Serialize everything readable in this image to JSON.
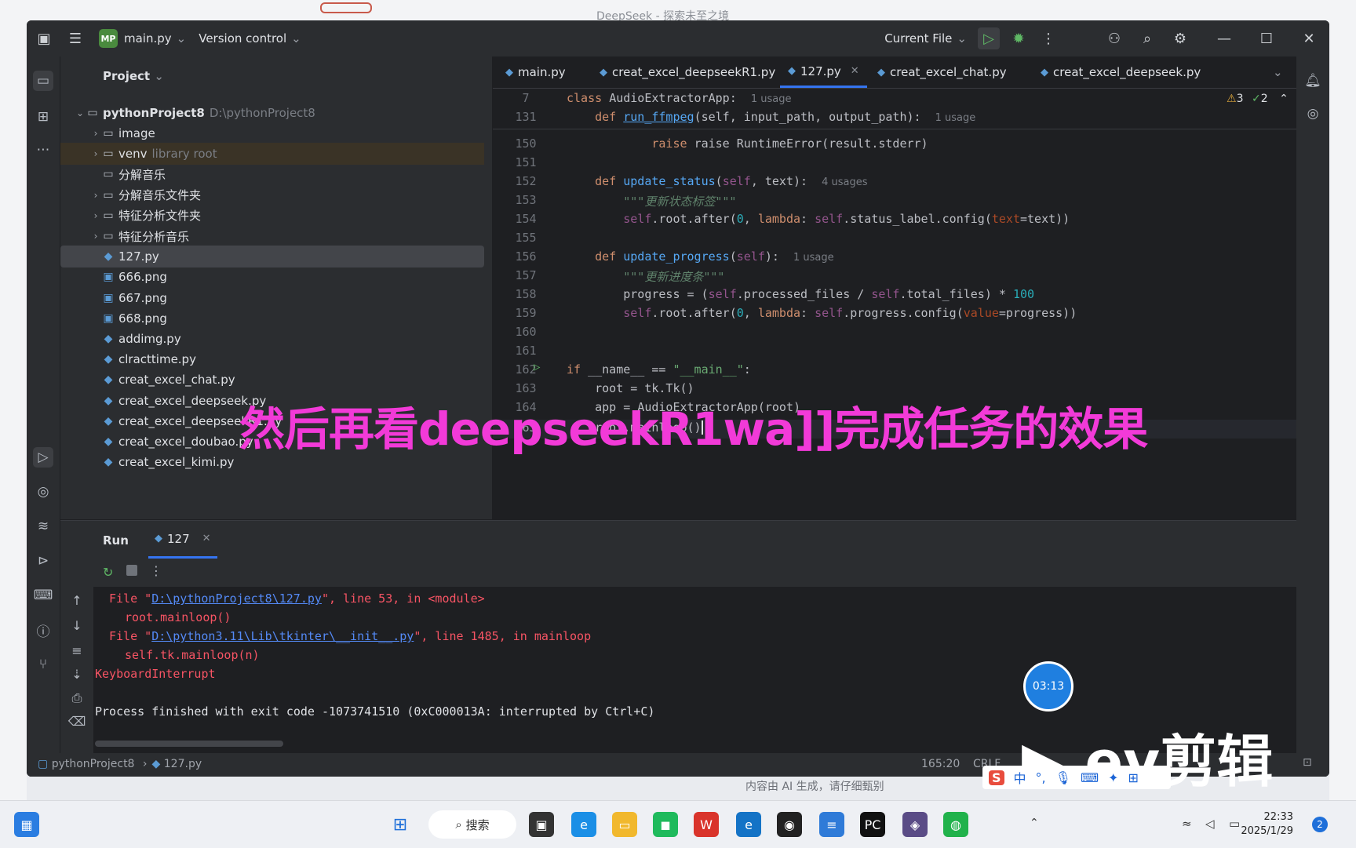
{
  "background_window": {
    "title": "DeepSeek - 探索未至之境",
    "caption": "内容由 AI 生成，请仔细甄别"
  },
  "topbar": {
    "project_badge": "MP",
    "file_name": "main.py",
    "version_control": "Version control",
    "run_config": "Current File"
  },
  "project": {
    "header": "Project",
    "root_name": "pythonProject8",
    "root_path": "D:\\pythonProject8",
    "items": [
      {
        "label": "image",
        "hint": "",
        "kind": "folder"
      },
      {
        "label": "venv",
        "hint": "library root",
        "kind": "folder"
      },
      {
        "label": "分解音乐",
        "hint": "",
        "kind": "folder"
      },
      {
        "label": "分解音乐文件夹",
        "hint": "",
        "kind": "folder"
      },
      {
        "label": "特征分析文件夹",
        "hint": "",
        "kind": "folder"
      },
      {
        "label": "特征分析音乐",
        "hint": "",
        "kind": "folder"
      },
      {
        "label": "127.py",
        "hint": "",
        "kind": "py"
      },
      {
        "label": "666.png",
        "hint": "",
        "kind": "png"
      },
      {
        "label": "667.png",
        "hint": "",
        "kind": "png"
      },
      {
        "label": "668.png",
        "hint": "",
        "kind": "png"
      },
      {
        "label": "addimg.py",
        "hint": "",
        "kind": "py"
      },
      {
        "label": "clracttime.py",
        "hint": "",
        "kind": "py"
      },
      {
        "label": "creat_excel_chat.py",
        "hint": "",
        "kind": "py"
      },
      {
        "label": "creat_excel_deepseek.py",
        "hint": "",
        "kind": "py"
      },
      {
        "label": "creat_excel_deepseekR1.py",
        "hint": "",
        "kind": "py"
      },
      {
        "label": "creat_excel_doubao.py",
        "hint": "",
        "kind": "py"
      },
      {
        "label": "creat_excel_kimi.py",
        "hint": "",
        "kind": "py"
      }
    ]
  },
  "editor": {
    "tabs": [
      "main.py",
      "creat_excel_deepseekR1.py",
      "127.py",
      "creat_excel_chat.py",
      "creat_excel_deepseek.py"
    ],
    "active_tab": "127.py",
    "warnings": "3",
    "checks": "2",
    "sticky": [
      {
        "ln": "7",
        "pre": "class ",
        "name": "AudioExtractorApp",
        "post": ":",
        "usage": "1 usage"
      },
      {
        "ln": "131",
        "pre": "    def ",
        "name": "run_ffmpeg",
        "post": "(self, input_path, output_path):",
        "usage": "1 usage"
      }
    ],
    "lines": {
      "l150": "150",
      "l150_text": "raise RuntimeError(result.stderr)",
      "l151": "151",
      "l152": "152",
      "l152_name": "update_status",
      "l152_args": "text",
      "l152_usage": "4 usages",
      "l153": "153",
      "l153_doc": "\"\"\"更新状态标签\"\"\"",
      "l154": "154",
      "l155": "155",
      "l156": "156",
      "l156_name": "update_progress",
      "l156_usage": "1 usage",
      "l157": "157",
      "l157_doc": "\"\"\"更新进度条\"\"\"",
      "l158": "158",
      "l159": "159",
      "l160": "160",
      "l161": "161",
      "l162": "162",
      "l163": "163",
      "l164": "164",
      "l164_text": "app = AudioExtractorApp(root)",
      "l165": "165",
      "l165_text": "root.mainloop()"
    }
  },
  "run": {
    "label": "Run",
    "tab": "127",
    "console": {
      "c1_pre": "File \"",
      "c1_link": "D:\\pythonProject8\\127.py",
      "c1_post": "\", line 53, in <module>",
      "c2": "root.mainloop()",
      "c3_pre": "File \"",
      "c3_link": "D:\\python3.11\\Lib\\tkinter\\__init__.py",
      "c3_post": "\", line 1485, in mainloop",
      "c4": "self.tk.mainloop(n)",
      "c5": "KeyboardInterrupt",
      "c6": "Process finished with exit code -1073741510 (0xC000013A: interrupted by Ctrl+C)"
    }
  },
  "statusbar": {
    "project": "pythonProject8",
    "file": "127.py",
    "position": "165:20",
    "encoding": "CRLF"
  },
  "overlay": {
    "caption": "然后再看deepseekR1wa]]完成任务的效果",
    "timer": "03:13",
    "logo": "ev剪辑",
    "ime_lang": "中"
  },
  "taskbar": {
    "search": "搜索",
    "time": "22:33",
    "date": "2025/1/29",
    "notif": "2"
  }
}
